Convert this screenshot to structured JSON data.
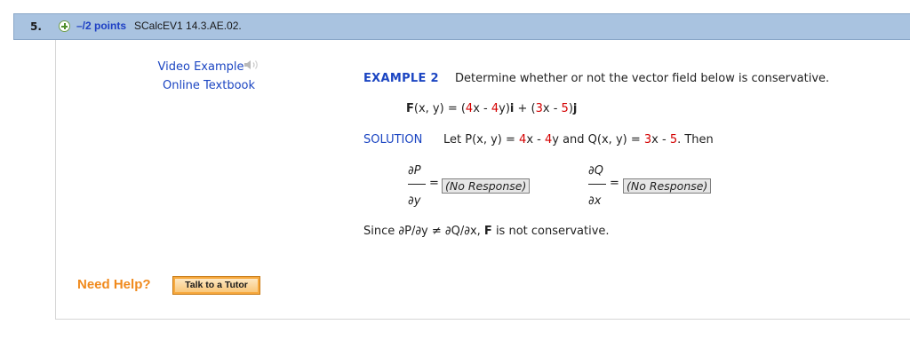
{
  "question": {
    "number": "5.",
    "points": "–/2 points",
    "id": "SCalcEV1 14.3.AE.02."
  },
  "links": {
    "video_example": "Video Example",
    "online_textbook": "Online Textbook"
  },
  "example": {
    "label": "EXAMPLE 2",
    "text": "Determine whether or not the vector field below is conservative."
  },
  "field": {
    "F": "F",
    "args1": "(x, y) = (",
    "c1": "4",
    "p1": "x - ",
    "c2": "4",
    "p2": "y)",
    "i": "i",
    "p3": " + (",
    "c3": "3",
    "p4": "x - ",
    "c4": "5",
    "p5": ")",
    "j": "j"
  },
  "solution": {
    "label": "SOLUTION",
    "s1": "Let P(x, y) = ",
    "c1": "4",
    "s2": "x - ",
    "c2": "4",
    "s3": "y and Q(x, y) = ",
    "c3": "3",
    "s4": "x - ",
    "c4": "5",
    "s5": ". Then"
  },
  "fractions": {
    "dp_num": "∂P",
    "dp_den": "∂y",
    "dq_num": "∂Q",
    "dq_den": "∂x",
    "equals": "=",
    "response1": "(No Response)",
    "response2": "(No Response)"
  },
  "conclusion": {
    "pre": "Since ∂P/∂y ≠ ∂Q/∂x, ",
    "F": "F",
    "post": " is not conservative."
  },
  "help": {
    "label": "Need Help?",
    "tutor_button": "Talk to a Tutor"
  },
  "colors": {
    "header_bg": "#a9c3e0",
    "link_blue": "#1b45c2",
    "value_red": "#d40000",
    "help_orange": "#f08a1d"
  }
}
